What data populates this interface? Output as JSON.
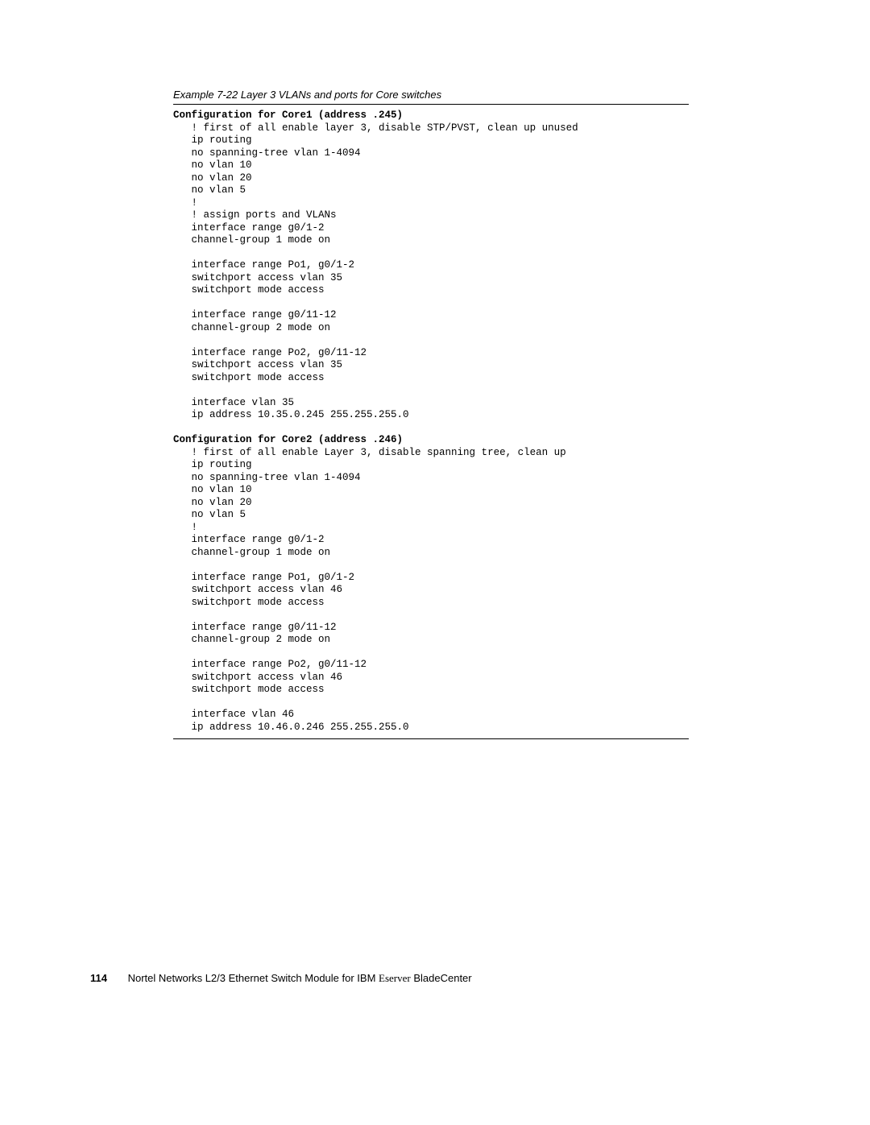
{
  "caption": "Example 7-22   Layer 3 VLANs and ports for Core switches",
  "block1_title": "Configuration for Core1 (address .245)",
  "block1_lines": [
    "   ! first of all enable layer 3, disable STP/PVST, clean up unused",
    "   ip routing",
    "   no spanning-tree vlan 1-4094",
    "   no vlan 10",
    "   no vlan 20",
    "   no vlan 5",
    "   !",
    "   ! assign ports and VLANs",
    "   interface range g0/1-2",
    "   channel-group 1 mode on",
    "",
    "   interface range Po1, g0/1-2",
    "   switchport access vlan 35",
    "   switchport mode access",
    "",
    "   interface range g0/11-12",
    "   channel-group 2 mode on",
    "",
    "   interface range Po2, g0/11-12",
    "   switchport access vlan 35",
    "   switchport mode access",
    "",
    "   interface vlan 35",
    "   ip address 10.35.0.245 255.255.255.0"
  ],
  "block2_title": "Configuration for Core2 (address .246)",
  "block2_lines": [
    "   ! first of all enable Layer 3, disable spanning tree, clean up",
    "   ip routing",
    "   no spanning-tree vlan 1-4094",
    "   no vlan 10",
    "   no vlan 20",
    "   no vlan 5",
    "   !",
    "   interface range g0/1-2",
    "   channel-group 1 mode on",
    "",
    "   interface range Po1, g0/1-2",
    "   switchport access vlan 46",
    "   switchport mode access",
    "",
    "   interface range g0/11-12",
    "   channel-group 2 mode on",
    "",
    "   interface range Po2, g0/11-12",
    "   switchport access vlan 46",
    "   switchport mode access",
    "",
    "   interface vlan 46",
    "   ip address 10.46.0.246 255.255.255.0"
  ],
  "page_number": "114",
  "footer_prefix": "Nortel Networks L2/3 Ethernet Switch Module for IBM ",
  "footer_brand_e": "E",
  "footer_brand_server": "server",
  "footer_suffix": " BladeCenter"
}
